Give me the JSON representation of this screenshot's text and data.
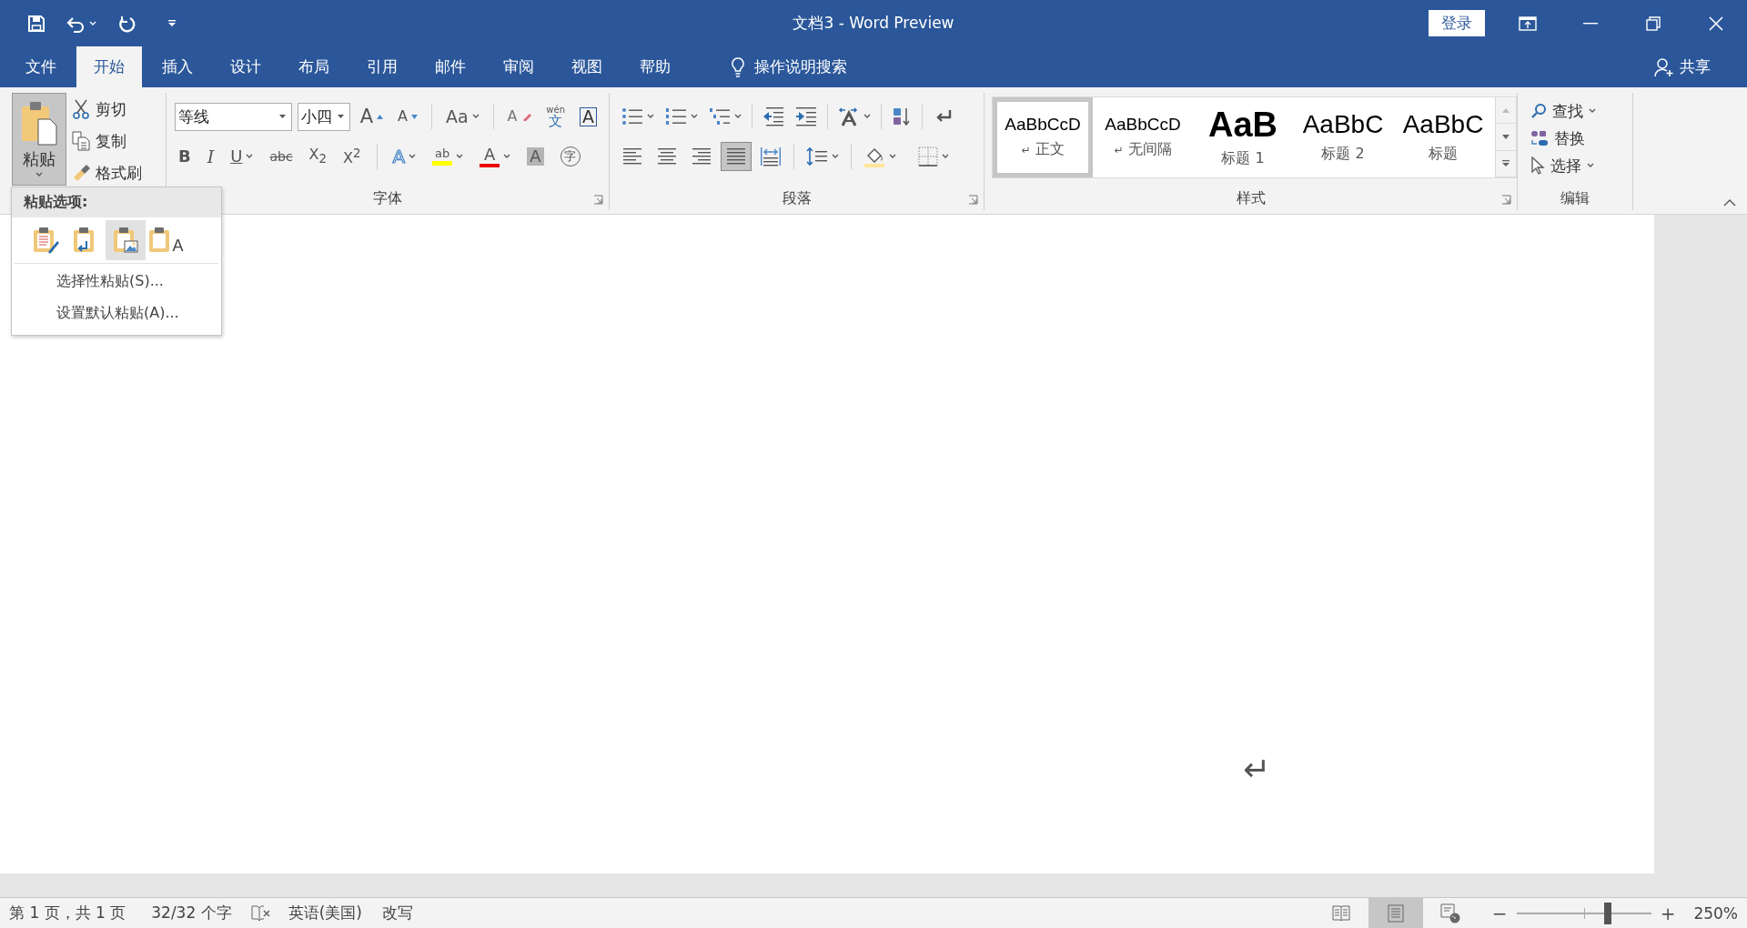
{
  "window": {
    "title": "文档3 - Word Preview",
    "sign_in": "登录"
  },
  "tabs": [
    {
      "label": "文件",
      "selected": false
    },
    {
      "label": "开始",
      "selected": true
    },
    {
      "label": "插入",
      "selected": false
    },
    {
      "label": "设计",
      "selected": false
    },
    {
      "label": "布局",
      "selected": false
    },
    {
      "label": "引用",
      "selected": false
    },
    {
      "label": "邮件",
      "selected": false
    },
    {
      "label": "审阅",
      "selected": false
    },
    {
      "label": "视图",
      "selected": false
    },
    {
      "label": "帮助",
      "selected": false
    }
  ],
  "search": {
    "placeholder": "操作说明搜索"
  },
  "share": "共享",
  "clipboard": {
    "paste": {
      "label": "粘贴",
      "pressed": true
    },
    "cut": "剪切",
    "copy": "复制",
    "format_painter": "格式刷"
  },
  "font": {
    "name": "等线",
    "size": "小四",
    "label": "字体",
    "buttons": [
      {
        "kind": "grow",
        "glyph": "A"
      },
      {
        "kind": "shrink",
        "glyph": "A"
      },
      {
        "kind": "case",
        "glyph": "Aa"
      },
      {
        "kind": "clear",
        "glyph": "A"
      },
      {
        "kind": "phonetic",
        "glyph": "文",
        "ruby": "wén"
      },
      {
        "kind": "boxed",
        "glyph": "A"
      },
      {
        "kind": "bold",
        "glyph": "B"
      },
      {
        "kind": "italic",
        "glyph": "I"
      },
      {
        "kind": "underline",
        "glyph": "U"
      },
      {
        "kind": "strike",
        "glyph": "abc"
      },
      {
        "kind": "script",
        "glyph": "X$_{2}$"
      },
      {
        "kind": "script",
        "glyph": "X$^{2}$"
      },
      {
        "kind": "effect",
        "glyph": "A"
      },
      {
        "kind": "highlight",
        "glyph": "ab"
      },
      {
        "kind": "color",
        "glyph": "A"
      },
      {
        "kind": "shade",
        "glyph": "A"
      },
      {
        "kind": "enclose",
        "glyph": "字"
      }
    ]
  },
  "paragraph": {
    "label": "段落",
    "alignments": [
      {
        "kind": "left",
        "selected": false
      },
      {
        "kind": "center",
        "selected": false
      },
      {
        "kind": "right",
        "selected": false
      },
      {
        "kind": "justify",
        "selected": true
      },
      {
        "kind": "distributed",
        "selected": false
      }
    ]
  },
  "styles": {
    "label": "样式",
    "items": [
      {
        "kind": "normal",
        "preview": "AaBbCcD",
        "mark": "↵",
        "label": "正文",
        "selected": true
      },
      {
        "kind": "normal",
        "preview": "AaBbCcD",
        "mark": "↵",
        "label": "无间隔",
        "selected": false
      },
      {
        "kind": "heading1",
        "preview": "AaB",
        "label": "标题 1",
        "selected": false
      },
      {
        "kind": "heading2",
        "preview": "AaBbC",
        "label": "标题 2",
        "selected": false
      },
      {
        "kind": "title",
        "preview": "AaBbC",
        "label": "标题",
        "selected": false
      }
    ]
  },
  "editing": {
    "label": "编辑",
    "items": [
      {
        "kind": "find",
        "label": "查找"
      },
      {
        "kind": "replace",
        "label": "替换"
      },
      {
        "kind": "select",
        "label": "选择"
      }
    ]
  },
  "paste_menu": {
    "title": "粘贴选项:",
    "options": [
      {
        "kind": "keep_source",
        "selected": false
      },
      {
        "kind": "merge",
        "selected": false
      },
      {
        "kind": "picture",
        "selected": true
      },
      {
        "kind": "text_only",
        "selected": false,
        "glyph": "A"
      }
    ],
    "items": [
      "选择性粘贴(S)...",
      "设置默认粘贴(A)..."
    ]
  },
  "document": {
    "paragraph_mark": "↵"
  },
  "status_bar": {
    "page": "第 1 页，共 1 页",
    "words": "32/32 个字",
    "language": "英语(美国)",
    "mode": "改写",
    "views": [
      {
        "kind": "read",
        "selected": false
      },
      {
        "kind": "print",
        "selected": true
      },
      {
        "kind": "web",
        "selected": false
      }
    ],
    "zoom": {
      "out": "−",
      "in": "+",
      "level": 0.68,
      "percent": "250%"
    }
  }
}
